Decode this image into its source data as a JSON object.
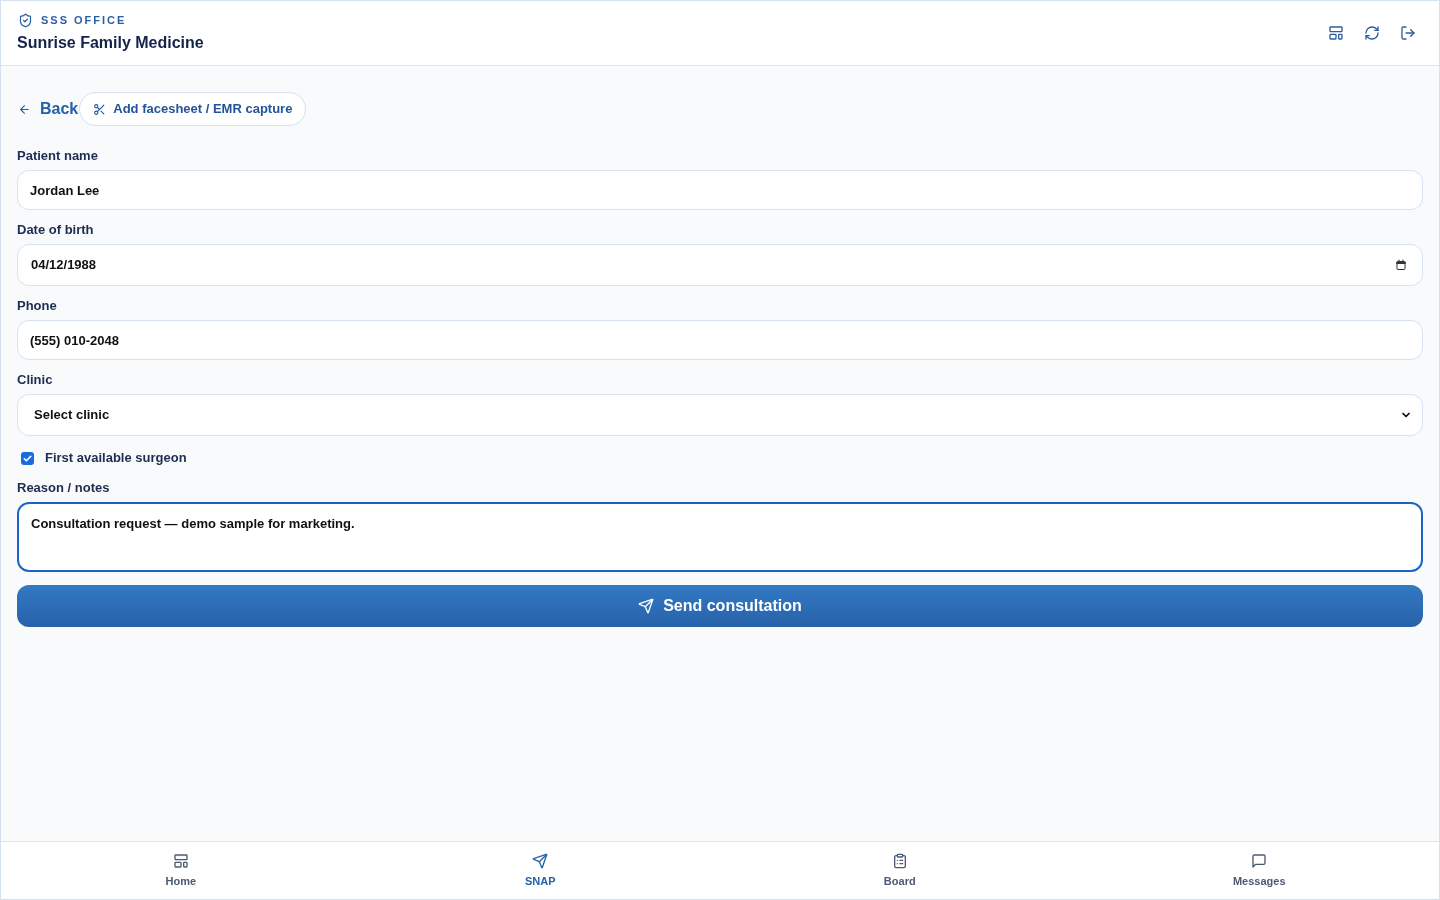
{
  "header": {
    "eyebrow": "SSS OFFICE",
    "title": "Sunrise Family Medicine"
  },
  "toolbar": {
    "back_link": "Back",
    "capture_button": "Add facesheet / EMR capture"
  },
  "form": {
    "fields": [
      {
        "kind": "text",
        "label": "Patient name",
        "value": "Jordan Lee",
        "focused": false
      },
      {
        "kind": "date",
        "label": "Date of birth",
        "value": "04/12/1988",
        "focused": false
      },
      {
        "kind": "text",
        "label": "Phone",
        "value": "(555) 010-2048",
        "focused": false
      },
      {
        "kind": "select",
        "label": "Clinic",
        "value": "Select clinic",
        "focused": false
      },
      {
        "kind": "checkbox",
        "label": "First available surgeon",
        "checked": true
      },
      {
        "kind": "textarea",
        "label": "Reason / notes",
        "value": "Consultation request — demo sample for marketing.",
        "focused": true
      }
    ],
    "submit_button": "Send consultation"
  },
  "bottom_nav": [
    {
      "label": "Home",
      "selected": false
    },
    {
      "label": "SNAP",
      "selected": true
    },
    {
      "label": "Board",
      "selected": false
    },
    {
      "label": "Messages",
      "selected": false
    }
  ]
}
